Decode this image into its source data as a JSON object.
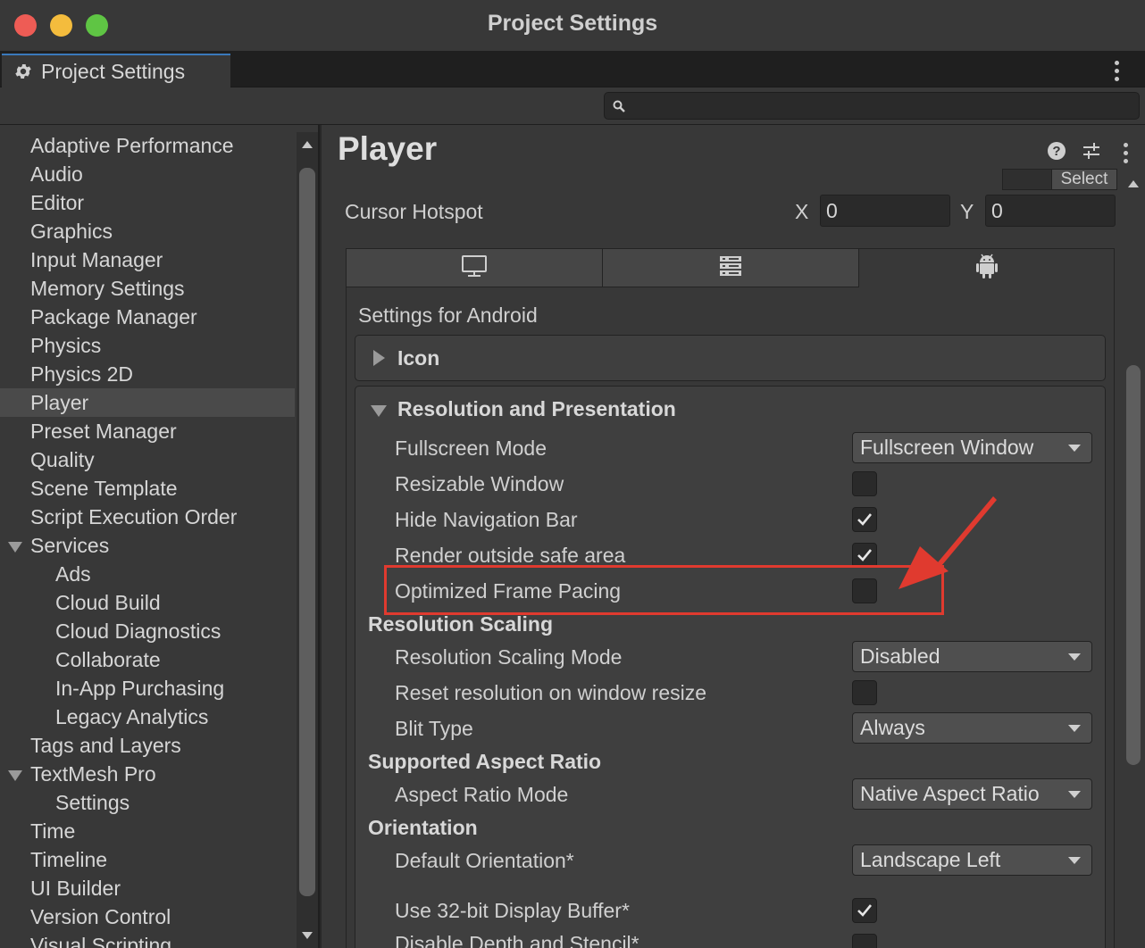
{
  "window": {
    "title": "Project Settings"
  },
  "tab": {
    "label": "Project Settings"
  },
  "search": {
    "placeholder": ""
  },
  "sidebar": {
    "items": [
      {
        "label": "Adaptive Performance"
      },
      {
        "label": "Audio"
      },
      {
        "label": "Editor"
      },
      {
        "label": "Graphics"
      },
      {
        "label": "Input Manager"
      },
      {
        "label": "Memory Settings"
      },
      {
        "label": "Package Manager"
      },
      {
        "label": "Physics"
      },
      {
        "label": "Physics 2D"
      },
      {
        "label": "Player",
        "selected": true
      },
      {
        "label": "Preset Manager"
      },
      {
        "label": "Quality"
      },
      {
        "label": "Scene Template"
      },
      {
        "label": "Script Execution Order"
      },
      {
        "label": "Services",
        "expanded": true
      },
      {
        "label": "Ads",
        "child": true
      },
      {
        "label": "Cloud Build",
        "child": true
      },
      {
        "label": "Cloud Diagnostics",
        "child": true
      },
      {
        "label": "Collaborate",
        "child": true
      },
      {
        "label": "In-App Purchasing",
        "child": true
      },
      {
        "label": "Legacy Analytics",
        "child": true
      },
      {
        "label": "Tags and Layers"
      },
      {
        "label": "TextMesh Pro",
        "expanded": true
      },
      {
        "label": "Settings",
        "child": true
      },
      {
        "label": "Time"
      },
      {
        "label": "Timeline"
      },
      {
        "label": "UI Builder"
      },
      {
        "label": "Version Control"
      },
      {
        "label": "Visual Scripting"
      }
    ]
  },
  "player": {
    "title": "Player",
    "select_label": "Select",
    "cursor_hotspot": {
      "label": "Cursor Hotspot",
      "x_label": "X",
      "x_value": "0",
      "y_label": "Y",
      "y_value": "0"
    },
    "settings_for": "Settings for Android",
    "icon_section": "Icon",
    "resolution_section": "Resolution and Presentation",
    "rows": {
      "fullscreen_mode": {
        "label": "Fullscreen Mode",
        "value": "Fullscreen Window"
      },
      "resizable_window": {
        "label": "Resizable Window",
        "checked": false
      },
      "hide_nav_bar": {
        "label": "Hide Navigation Bar",
        "checked": true
      },
      "render_outside": {
        "label": "Render outside safe area",
        "checked": true
      },
      "frame_pacing": {
        "label": "Optimized Frame Pacing",
        "checked": false
      },
      "resolution_scaling_header": "Resolution Scaling",
      "scaling_mode": {
        "label": "Resolution Scaling Mode",
        "value": "Disabled"
      },
      "reset_resolution": {
        "label": "Reset resolution on window resize",
        "checked": false
      },
      "blit_type": {
        "label": "Blit Type",
        "value": "Always"
      },
      "aspect_header": "Supported Aspect Ratio",
      "aspect_mode": {
        "label": "Aspect Ratio Mode",
        "value": "Native Aspect Ratio"
      },
      "orientation_header": "Orientation",
      "default_orientation": {
        "label": "Default Orientation*",
        "value": "Landscape Left"
      },
      "display_buffer": {
        "label": "Use 32-bit Display Buffer*",
        "checked": true
      },
      "depth_stencil": {
        "label": "Disable Depth and Stencil*",
        "checked": false
      }
    }
  },
  "colors": {
    "highlight": "#e03a2f",
    "tab_accent": "#3a79bb"
  },
  "icons": [
    "gear-icon",
    "search-icon",
    "help-icon",
    "sliders-icon",
    "kebab-menu-icon",
    "monitor-icon",
    "server-icon",
    "android-icon",
    "checkmark-icon",
    "annotation-arrow"
  ]
}
